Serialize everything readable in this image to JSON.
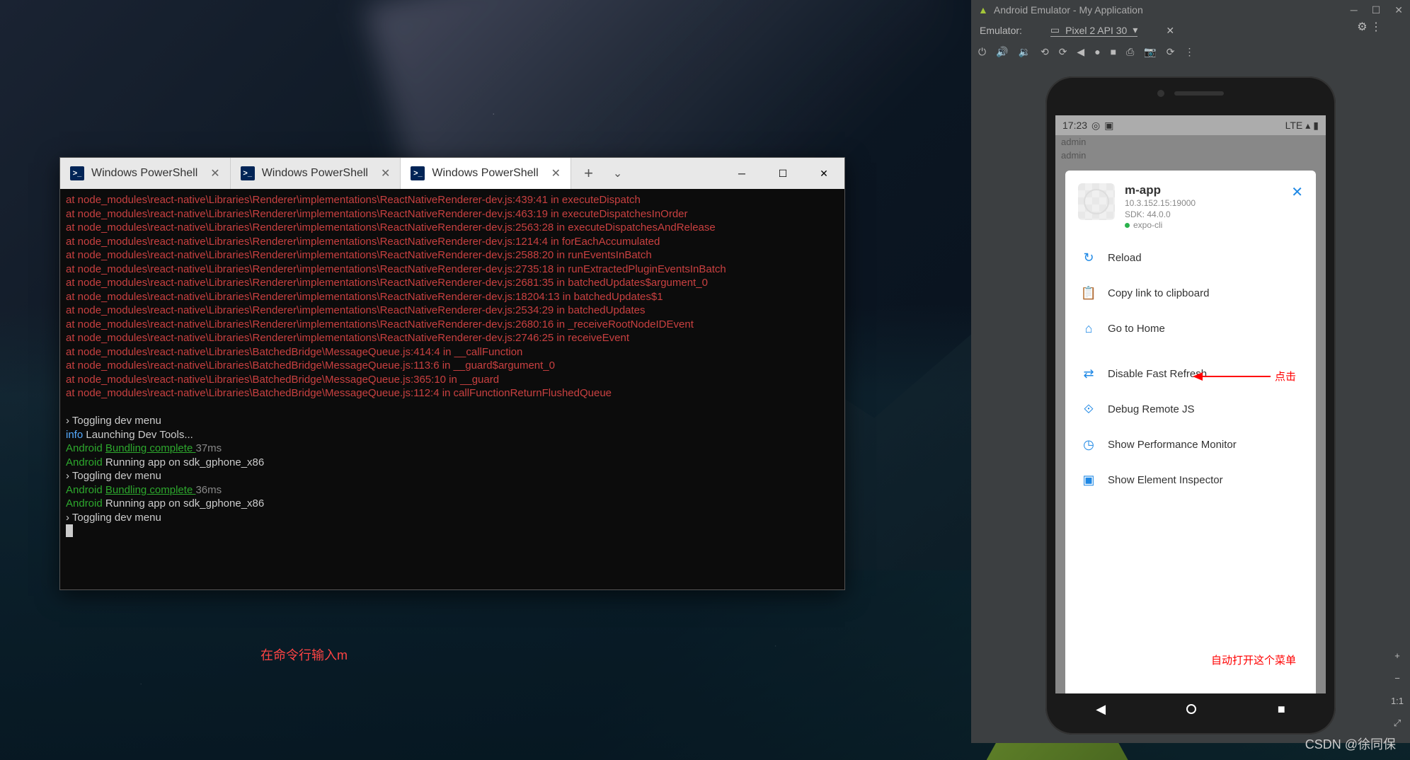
{
  "terminal": {
    "tabs": [
      {
        "label": "Windows PowerShell",
        "active": false
      },
      {
        "label": "Windows PowerShell",
        "active": false
      },
      {
        "label": "Windows PowerShell",
        "active": true
      }
    ],
    "errors": [
      "at node_modules\\react-native\\Libraries\\Renderer\\implementations\\ReactNativeRenderer-dev.js:439:41 in executeDispatch",
      "at node_modules\\react-native\\Libraries\\Renderer\\implementations\\ReactNativeRenderer-dev.js:463:19 in executeDispatchesInOrder",
      "at node_modules\\react-native\\Libraries\\Renderer\\implementations\\ReactNativeRenderer-dev.js:2563:28 in executeDispatchesAndRelease",
      "at node_modules\\react-native\\Libraries\\Renderer\\implementations\\ReactNativeRenderer-dev.js:1214:4 in forEachAccumulated",
      "at node_modules\\react-native\\Libraries\\Renderer\\implementations\\ReactNativeRenderer-dev.js:2588:20 in runEventsInBatch",
      "at node_modules\\react-native\\Libraries\\Renderer\\implementations\\ReactNativeRenderer-dev.js:2735:18 in runExtractedPluginEventsInBatch",
      "at node_modules\\react-native\\Libraries\\Renderer\\implementations\\ReactNativeRenderer-dev.js:2681:35 in batchedUpdates$argument_0",
      "at node_modules\\react-native\\Libraries\\Renderer\\implementations\\ReactNativeRenderer-dev.js:18204:13 in batchedUpdates$1",
      "at node_modules\\react-native\\Libraries\\Renderer\\implementations\\ReactNativeRenderer-dev.js:2534:29 in batchedUpdates",
      "at node_modules\\react-native\\Libraries\\Renderer\\implementations\\ReactNativeRenderer-dev.js:2680:16 in _receiveRootNodeIDEvent",
      "at node_modules\\react-native\\Libraries\\Renderer\\implementations\\ReactNativeRenderer-dev.js:2746:25 in receiveEvent",
      "at node_modules\\react-native\\Libraries\\BatchedBridge\\MessageQueue.js:414:4 in __callFunction",
      "at node_modules\\react-native\\Libraries\\BatchedBridge\\MessageQueue.js:113:6 in __guard$argument_0",
      "at node_modules\\react-native\\Libraries\\BatchedBridge\\MessageQueue.js:365:10 in __guard",
      "at node_modules\\react-native\\Libraries\\BatchedBridge\\MessageQueue.js:112:4 in callFunctionReturnFlushedQueue"
    ],
    "log": [
      {
        "type": "prompt",
        "text": "› Toggling dev menu"
      },
      {
        "type": "info",
        "prefix": "info",
        "text": " Launching Dev Tools..."
      },
      {
        "type": "bundle",
        "prefix": "Android ",
        "mid": "Bundling complete ",
        "time": "37ms"
      },
      {
        "type": "run",
        "prefix": "Android ",
        "text": "Running app on sdk_gphone_x86"
      },
      {
        "type": "prompt",
        "text": "› Toggling dev menu"
      },
      {
        "type": "bundle",
        "prefix": "Android ",
        "mid": "Bundling complete ",
        "time": "36ms"
      },
      {
        "type": "run",
        "prefix": "Android ",
        "text": "Running app on sdk_gphone_x86"
      },
      {
        "type": "prompt",
        "text": "› Toggling dev menu"
      }
    ]
  },
  "annotations": {
    "terminal_hint": "在命令行输入m",
    "click_hint": "点击",
    "menu_hint": "自动打开这个菜单"
  },
  "emulator": {
    "window_title": "Android Emulator - My Application",
    "label": "Emulator:",
    "device": "Pixel 2 API 30",
    "zoom_plus": "+",
    "zoom_minus": "−",
    "zoom_fit": "1:1"
  },
  "phone": {
    "time": "17:23",
    "signal": "LTE",
    "admin_rows": [
      "admin",
      "admin"
    ]
  },
  "dev_menu": {
    "app_name": "m-app",
    "address": "10.3.152.15:19000",
    "sdk_line": "SDK: 44.0.0",
    "runner": "expo-cli",
    "items_a": [
      {
        "icon": "↻",
        "label": "Reload",
        "name": "reload"
      },
      {
        "icon": "📋",
        "label": "Copy link to clipboard",
        "name": "copy-link"
      },
      {
        "icon": "⌂",
        "label": "Go to Home",
        "name": "go-home"
      }
    ],
    "items_b": [
      {
        "icon": "⇄",
        "label": "Disable Fast Refresh",
        "name": "disable-fast-refresh"
      },
      {
        "icon": "⟐",
        "label": "Debug Remote JS",
        "name": "debug-remote-js"
      },
      {
        "icon": "◷",
        "label": "Show Performance Monitor",
        "name": "perf-monitor"
      },
      {
        "icon": "▣",
        "label": "Show Element Inspector",
        "name": "element-inspector"
      }
    ]
  },
  "watermark": "CSDN @徐同保"
}
